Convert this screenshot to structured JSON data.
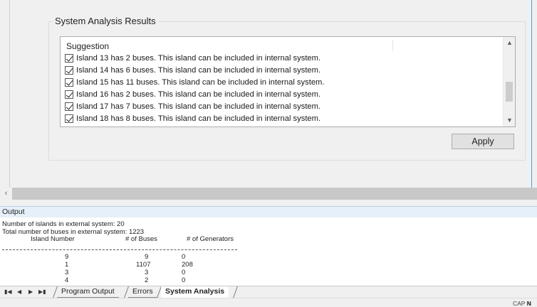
{
  "groupbox": {
    "title": "System Analysis Results"
  },
  "suggestions": {
    "header": "Suggestion",
    "rows": [
      "Island 13 has 2 buses. This island can be included in internal system.",
      "Island 14 has 6 buses. This island can be included in internal system.",
      "Island 15 has 11 buses. This island can be included in internal system.",
      "Island 16 has 2 buses. This island can be included in internal system.",
      "Island 17 has 7 buses. This island can be included in internal system.",
      "Island 18 has 8 buses. This island can be included in internal system."
    ]
  },
  "apply_label": "Apply",
  "output": {
    "title": "Output",
    "line1": "Number of islands in external system: 20",
    "line2": "Total number of buses in external system: 1223",
    "columns": {
      "island": "Island Number",
      "buses": "# of Buses",
      "generators": "# of Generators"
    },
    "rows": [
      {
        "island": "9",
        "buses": "9",
        "generators": "0"
      },
      {
        "island": "1",
        "buses": "1107",
        "generators": "208"
      },
      {
        "island": "3",
        "buses": "3",
        "generators": "0"
      },
      {
        "island": "4",
        "buses": "2",
        "generators": "0"
      }
    ]
  },
  "tabs": [
    "Program Output",
    "Errors",
    "System Analysis"
  ],
  "status": {
    "label": "CAP",
    "value": "N"
  }
}
